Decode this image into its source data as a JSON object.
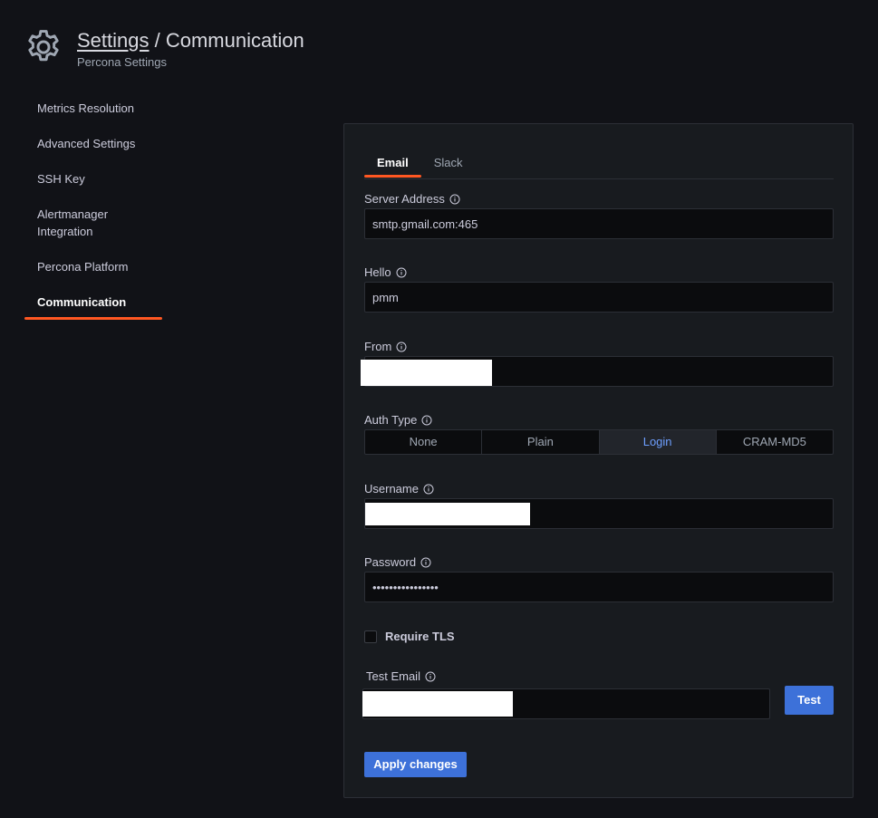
{
  "header": {
    "breadcrumb_parent": "Settings",
    "breadcrumb_separator": " / ",
    "breadcrumb_current": "Communication",
    "subtitle": "Percona Settings",
    "icon": "gear-icon"
  },
  "sidebar": {
    "items": [
      {
        "label": "Metrics Resolution"
      },
      {
        "label": "Advanced Settings"
      },
      {
        "label": "SSH Key"
      },
      {
        "label": "Alertmanager Integration"
      },
      {
        "label": "Percona Platform"
      },
      {
        "label": "Communication",
        "active": true
      }
    ]
  },
  "tabs": [
    {
      "label": "Email",
      "active": true
    },
    {
      "label": "Slack"
    }
  ],
  "form": {
    "server_address": {
      "label": "Server Address",
      "value": "smtp.gmail.com:465"
    },
    "hello": {
      "label": "Hello",
      "value": "pmm"
    },
    "from": {
      "label": "From",
      "value": ""
    },
    "auth_type": {
      "label": "Auth Type",
      "options": [
        "None",
        "Plain",
        "Login",
        "CRAM-MD5"
      ],
      "selected": "Login"
    },
    "username": {
      "label": "Username",
      "value": ""
    },
    "password": {
      "label": "Password",
      "value": "••••••••••••••••"
    },
    "require_tls": {
      "label": "Require TLS",
      "checked": false
    },
    "test_email": {
      "label": "Test Email",
      "value": ""
    },
    "test_button": "Test",
    "apply_button": "Apply changes"
  },
  "colors": {
    "accent_orange": "#ff5722",
    "primary_blue": "#3d71d9",
    "selected_text_blue": "#6e9fff",
    "background": "#111217",
    "panel": "#181b1f"
  }
}
